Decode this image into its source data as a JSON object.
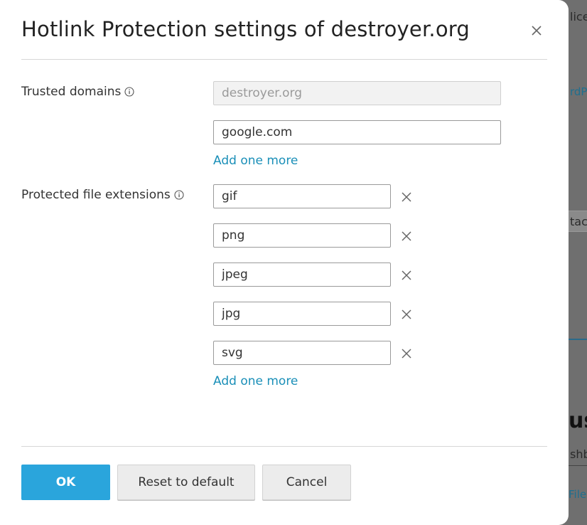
{
  "background": {
    "fragments": [
      "lice",
      "rdPr",
      "tach",
      "us",
      "shb",
      "File"
    ]
  },
  "dialog": {
    "title": "Hotlink Protection settings of destroyer.org",
    "trusted_domains": {
      "label": "Trusted domains",
      "primary_domain": "destroyer.org",
      "entries": [
        "google.com"
      ],
      "add_more": "Add one more"
    },
    "protected_extensions": {
      "label": "Protected file extensions",
      "entries": [
        "gif",
        "png",
        "jpeg",
        "jpg",
        "svg"
      ],
      "add_more": "Add one more"
    },
    "buttons": {
      "ok": "OK",
      "reset": "Reset to default",
      "cancel": "Cancel"
    }
  }
}
